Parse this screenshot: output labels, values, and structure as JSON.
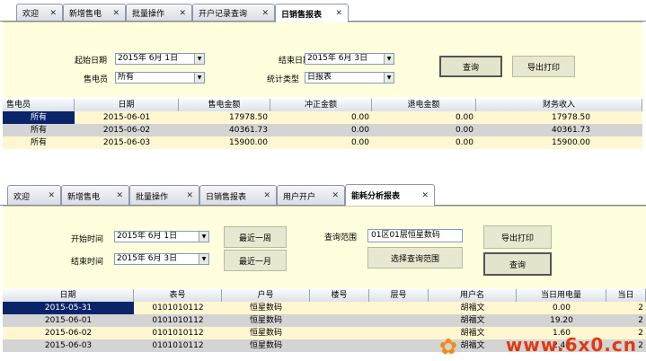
{
  "panel1": {
    "tabs": [
      {
        "label": "欢迎",
        "active": false
      },
      {
        "label": "新增售电",
        "active": false
      },
      {
        "label": "批量操作",
        "active": false
      },
      {
        "label": "开户记录查询",
        "active": false
      },
      {
        "label": "日销售报表",
        "active": true
      }
    ],
    "form": {
      "start_date_label": "起始日期",
      "start_date_value": "2015年 6月 1日",
      "end_date_label": "结束日期",
      "end_date_value": "2015年 6月 3日",
      "seller_label": "售电员",
      "seller_value": "所有",
      "stat_type_label": "统计类型",
      "stat_type_value": "日报表",
      "query_button": "查询",
      "export_button": "导出打印"
    },
    "grid": {
      "columns": [
        "售电员",
        "日期",
        "售电金额",
        "冲正金额",
        "退电金额",
        "财务收入"
      ],
      "rows": [
        [
          "所有",
          "2015-06-01",
          "17978.50",
          "0.00",
          "0.00",
          "17978.50"
        ],
        [
          "所有",
          "2015-06-02",
          "40361.73",
          "0.00",
          "0.00",
          "40361.73"
        ],
        [
          "所有",
          "2015-06-03",
          "15900.00",
          "0.00",
          "0.00",
          "15900.00"
        ]
      ]
    }
  },
  "panel2": {
    "tabs": [
      {
        "label": "欢迎",
        "active": false
      },
      {
        "label": "新增售电",
        "active": false
      },
      {
        "label": "批量操作",
        "active": false
      },
      {
        "label": "日销售报表",
        "active": false
      },
      {
        "label": "用户开户",
        "active": false
      },
      {
        "label": "能耗分析报表",
        "active": true
      }
    ],
    "form": {
      "start_time_label": "开始时间",
      "start_time_value": "2015年 6月 1日",
      "end_time_label": "结束时间",
      "end_time_value": "2015年 6月 3日",
      "recent_week_button": "最近一周",
      "recent_month_button": "最近一月",
      "range_label": "查询范围",
      "range_value": "01区01层恒星数码",
      "select_range_button": "选择查询范围",
      "export_button": "导出打印",
      "query_button": "查询"
    },
    "grid": {
      "columns": [
        "日期",
        "表号",
        "户号",
        "楼号",
        "层号",
        "用户名",
        "当日用电量",
        "当日"
      ],
      "rows": [
        [
          "2015-05-31",
          "0101010112",
          "恒星数码",
          "",
          "",
          "胡福文",
          "0.00",
          "2"
        ],
        [
          "2015-06-01",
          "0101010112",
          "恒星数码",
          "",
          "",
          "胡福文",
          "19.20",
          "2"
        ],
        [
          "2015-06-02",
          "0101010112",
          "恒星数码",
          "",
          "",
          "胡福文",
          "1.60",
          "2"
        ],
        [
          "2015-06-03",
          "0101010112",
          "恒星数码",
          "",
          "",
          "胡福文",
          "2.40",
          "2"
        ]
      ]
    }
  },
  "watermark": "www.6x0.cn",
  "colors": {
    "form_bg": "#ffffdd",
    "row_yellow": "#fff7d2",
    "row_gray": "#d4d4d4",
    "selected": "#0a246a",
    "watermark": "#e03a10"
  }
}
